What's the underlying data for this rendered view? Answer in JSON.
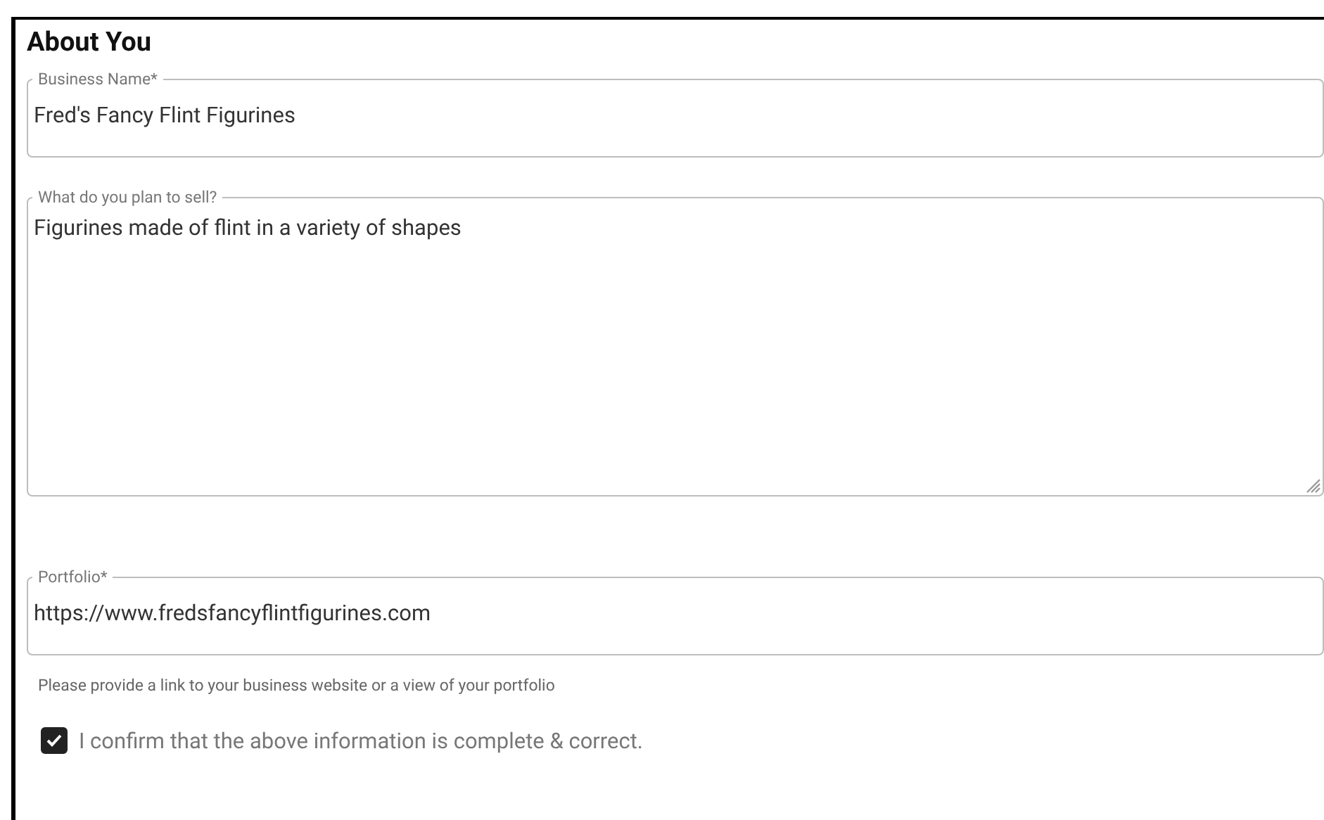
{
  "section": {
    "title": "About You"
  },
  "fields": [
    {
      "kind": "input",
      "label": "Business Name*",
      "value": "Fred's Fancy Flint Figurines"
    },
    {
      "kind": "textarea",
      "label": "What do you plan to sell?",
      "value": "Figurines made of flint in a variety of shapes"
    },
    {
      "kind": "input",
      "label": "Portfolio*",
      "value": "https://www.fredsfancyflintfigurines.com",
      "helper": "Please provide a link to your business website or a view of your portfolio"
    }
  ],
  "confirm": {
    "label": "I confirm that the above information is complete & correct.",
    "checked": true
  }
}
